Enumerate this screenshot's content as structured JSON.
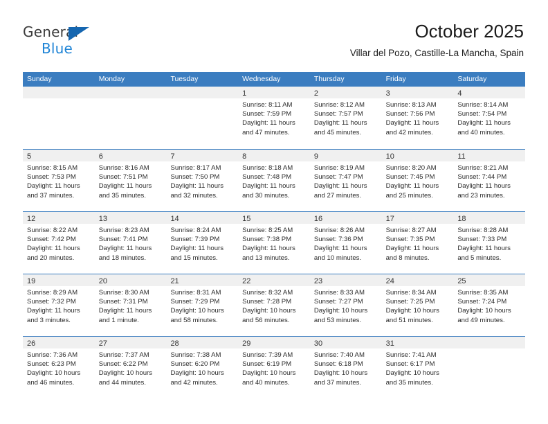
{
  "branding": {
    "logo_text_top": "General",
    "logo_text_bottom": "Blue",
    "accent_color": "#1e84d6",
    "triangle_color": "#1566b0"
  },
  "header": {
    "title": "October 2025",
    "subtitle": "Villar del Pozo, Castille-La Mancha, Spain"
  },
  "calendar": {
    "header_bg_color": "#3b7dc0",
    "day_strip_bg_color": "#f0f0f0",
    "weekdays": [
      "Sunday",
      "Monday",
      "Tuesday",
      "Wednesday",
      "Thursday",
      "Friday",
      "Saturday"
    ],
    "weeks": [
      [
        {
          "day": "",
          "lines": []
        },
        {
          "day": "",
          "lines": []
        },
        {
          "day": "",
          "lines": []
        },
        {
          "day": "1",
          "lines": [
            "Sunrise: 8:11 AM",
            "Sunset: 7:59 PM",
            "Daylight: 11 hours",
            "and 47 minutes."
          ]
        },
        {
          "day": "2",
          "lines": [
            "Sunrise: 8:12 AM",
            "Sunset: 7:57 PM",
            "Daylight: 11 hours",
            "and 45 minutes."
          ]
        },
        {
          "day": "3",
          "lines": [
            "Sunrise: 8:13 AM",
            "Sunset: 7:56 PM",
            "Daylight: 11 hours",
            "and 42 minutes."
          ]
        },
        {
          "day": "4",
          "lines": [
            "Sunrise: 8:14 AM",
            "Sunset: 7:54 PM",
            "Daylight: 11 hours",
            "and 40 minutes."
          ]
        }
      ],
      [
        {
          "day": "5",
          "lines": [
            "Sunrise: 8:15 AM",
            "Sunset: 7:53 PM",
            "Daylight: 11 hours",
            "and 37 minutes."
          ]
        },
        {
          "day": "6",
          "lines": [
            "Sunrise: 8:16 AM",
            "Sunset: 7:51 PM",
            "Daylight: 11 hours",
            "and 35 minutes."
          ]
        },
        {
          "day": "7",
          "lines": [
            "Sunrise: 8:17 AM",
            "Sunset: 7:50 PM",
            "Daylight: 11 hours",
            "and 32 minutes."
          ]
        },
        {
          "day": "8",
          "lines": [
            "Sunrise: 8:18 AM",
            "Sunset: 7:48 PM",
            "Daylight: 11 hours",
            "and 30 minutes."
          ]
        },
        {
          "day": "9",
          "lines": [
            "Sunrise: 8:19 AM",
            "Sunset: 7:47 PM",
            "Daylight: 11 hours",
            "and 27 minutes."
          ]
        },
        {
          "day": "10",
          "lines": [
            "Sunrise: 8:20 AM",
            "Sunset: 7:45 PM",
            "Daylight: 11 hours",
            "and 25 minutes."
          ]
        },
        {
          "day": "11",
          "lines": [
            "Sunrise: 8:21 AM",
            "Sunset: 7:44 PM",
            "Daylight: 11 hours",
            "and 23 minutes."
          ]
        }
      ],
      [
        {
          "day": "12",
          "lines": [
            "Sunrise: 8:22 AM",
            "Sunset: 7:42 PM",
            "Daylight: 11 hours",
            "and 20 minutes."
          ]
        },
        {
          "day": "13",
          "lines": [
            "Sunrise: 8:23 AM",
            "Sunset: 7:41 PM",
            "Daylight: 11 hours",
            "and 18 minutes."
          ]
        },
        {
          "day": "14",
          "lines": [
            "Sunrise: 8:24 AM",
            "Sunset: 7:39 PM",
            "Daylight: 11 hours",
            "and 15 minutes."
          ]
        },
        {
          "day": "15",
          "lines": [
            "Sunrise: 8:25 AM",
            "Sunset: 7:38 PM",
            "Daylight: 11 hours",
            "and 13 minutes."
          ]
        },
        {
          "day": "16",
          "lines": [
            "Sunrise: 8:26 AM",
            "Sunset: 7:36 PM",
            "Daylight: 11 hours",
            "and 10 minutes."
          ]
        },
        {
          "day": "17",
          "lines": [
            "Sunrise: 8:27 AM",
            "Sunset: 7:35 PM",
            "Daylight: 11 hours",
            "and 8 minutes."
          ]
        },
        {
          "day": "18",
          "lines": [
            "Sunrise: 8:28 AM",
            "Sunset: 7:33 PM",
            "Daylight: 11 hours",
            "and 5 minutes."
          ]
        }
      ],
      [
        {
          "day": "19",
          "lines": [
            "Sunrise: 8:29 AM",
            "Sunset: 7:32 PM",
            "Daylight: 11 hours",
            "and 3 minutes."
          ]
        },
        {
          "day": "20",
          "lines": [
            "Sunrise: 8:30 AM",
            "Sunset: 7:31 PM",
            "Daylight: 11 hours",
            "and 1 minute."
          ]
        },
        {
          "day": "21",
          "lines": [
            "Sunrise: 8:31 AM",
            "Sunset: 7:29 PM",
            "Daylight: 10 hours",
            "and 58 minutes."
          ]
        },
        {
          "day": "22",
          "lines": [
            "Sunrise: 8:32 AM",
            "Sunset: 7:28 PM",
            "Daylight: 10 hours",
            "and 56 minutes."
          ]
        },
        {
          "day": "23",
          "lines": [
            "Sunrise: 8:33 AM",
            "Sunset: 7:27 PM",
            "Daylight: 10 hours",
            "and 53 minutes."
          ]
        },
        {
          "day": "24",
          "lines": [
            "Sunrise: 8:34 AM",
            "Sunset: 7:25 PM",
            "Daylight: 10 hours",
            "and 51 minutes."
          ]
        },
        {
          "day": "25",
          "lines": [
            "Sunrise: 8:35 AM",
            "Sunset: 7:24 PM",
            "Daylight: 10 hours",
            "and 49 minutes."
          ]
        }
      ],
      [
        {
          "day": "26",
          "lines": [
            "Sunrise: 7:36 AM",
            "Sunset: 6:23 PM",
            "Daylight: 10 hours",
            "and 46 minutes."
          ]
        },
        {
          "day": "27",
          "lines": [
            "Sunrise: 7:37 AM",
            "Sunset: 6:22 PM",
            "Daylight: 10 hours",
            "and 44 minutes."
          ]
        },
        {
          "day": "28",
          "lines": [
            "Sunrise: 7:38 AM",
            "Sunset: 6:20 PM",
            "Daylight: 10 hours",
            "and 42 minutes."
          ]
        },
        {
          "day": "29",
          "lines": [
            "Sunrise: 7:39 AM",
            "Sunset: 6:19 PM",
            "Daylight: 10 hours",
            "and 40 minutes."
          ]
        },
        {
          "day": "30",
          "lines": [
            "Sunrise: 7:40 AM",
            "Sunset: 6:18 PM",
            "Daylight: 10 hours",
            "and 37 minutes."
          ]
        },
        {
          "day": "31",
          "lines": [
            "Sunrise: 7:41 AM",
            "Sunset: 6:17 PM",
            "Daylight: 10 hours",
            "and 35 minutes."
          ]
        },
        {
          "day": "",
          "lines": []
        }
      ]
    ]
  }
}
